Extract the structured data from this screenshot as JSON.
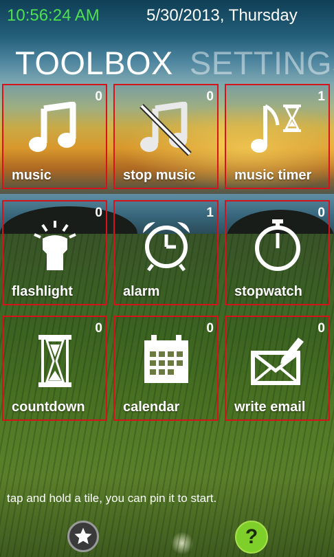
{
  "status": {
    "time": "10:56:24 AM",
    "date": "5/30/2013, Thursday",
    "time_color": "#4fe04f"
  },
  "pivot": {
    "tabs": [
      {
        "label": "TOOLBOX",
        "active": true
      },
      {
        "label": "SETTINGS",
        "active": false
      }
    ]
  },
  "tiles": [
    {
      "label": "music",
      "count": "0",
      "icon": "music-note-icon"
    },
    {
      "label": "stop music",
      "count": "0",
      "icon": "music-off-icon"
    },
    {
      "label": "music timer",
      "count": "1",
      "icon": "music-timer-icon"
    },
    {
      "label": "flashlight",
      "count": "0",
      "icon": "flashlight-icon"
    },
    {
      "label": "alarm",
      "count": "1",
      "icon": "alarm-clock-icon"
    },
    {
      "label": "stopwatch",
      "count": "0",
      "icon": "stopwatch-icon"
    },
    {
      "label": "countdown",
      "count": "0",
      "icon": "hourglass-icon"
    },
    {
      "label": "calendar",
      "count": "0",
      "icon": "calendar-icon"
    },
    {
      "label": "write email",
      "count": "0",
      "icon": "email-edit-icon"
    }
  ],
  "footer": {
    "hint": "tap and hold a tile, you can pin it to start.",
    "help_label": "?"
  },
  "colors": {
    "tile_border": "#d6121a",
    "help_button": "#7fcf2a"
  }
}
